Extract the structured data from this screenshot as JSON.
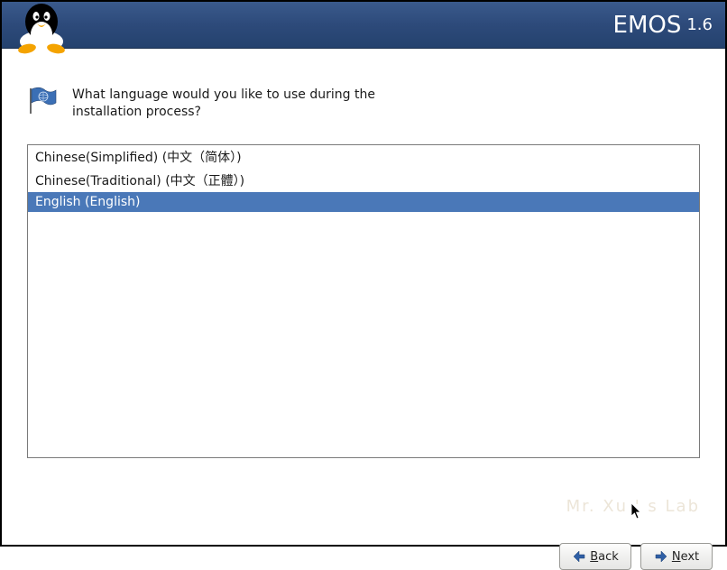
{
  "header": {
    "title": "EMOS",
    "version": "1.6"
  },
  "prompt": {
    "text": "What language would you like to use during the installation process?"
  },
  "languages": {
    "items": [
      {
        "label": "Chinese(Simplified) (中文（简体）)",
        "selected": false
      },
      {
        "label": "Chinese(Traditional) (中文（正體）)",
        "selected": false
      },
      {
        "label": "English (English)",
        "selected": true
      }
    ]
  },
  "buttons": {
    "back_prefix": "B",
    "back_rest": "ack",
    "next_prefix": "N",
    "next_rest": "ext"
  },
  "watermark": "Mr. Xu ' s Lab"
}
